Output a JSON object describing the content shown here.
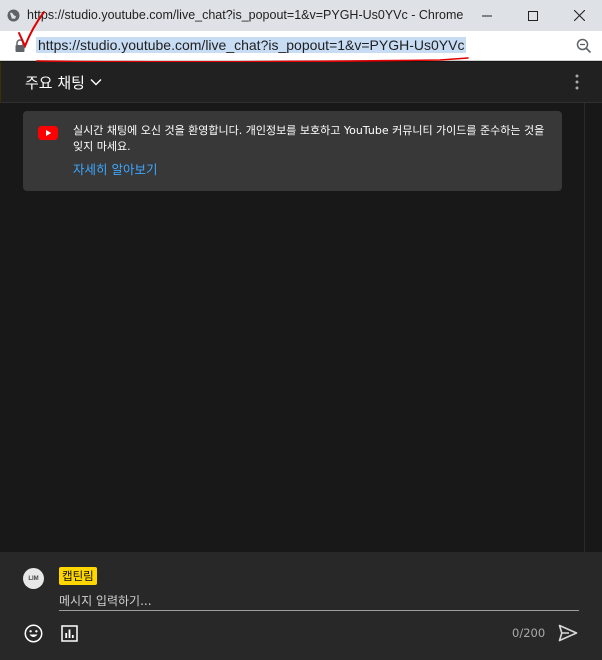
{
  "window": {
    "title": "https://studio.youtube.com/live_chat?is_popout=1&v=PYGH-Us0YVc - Chrome"
  },
  "addressbar": {
    "url": "https://studio.youtube.com/live_chat?is_popout=1&v=PYGH-Us0YVc"
  },
  "header": {
    "title": "주요 채팅"
  },
  "welcome": {
    "message": "실시간 채팅에 오신 것을 환영합니다. 개인정보를 보호하고 YouTube 커뮤니티 가이드를 준수하는 것을 잊지 마세요.",
    "learn_more": "자세히 알아보기"
  },
  "input": {
    "avatar_text": "LIM",
    "author": "캡틴림",
    "placeholder": "메시지 입력하기...",
    "counter": "0/200"
  },
  "colors": {
    "accent_link": "#3ea6ff",
    "author_badge": "#ffd600",
    "youtube_red": "#ff0000",
    "annotation": "#e00000"
  }
}
